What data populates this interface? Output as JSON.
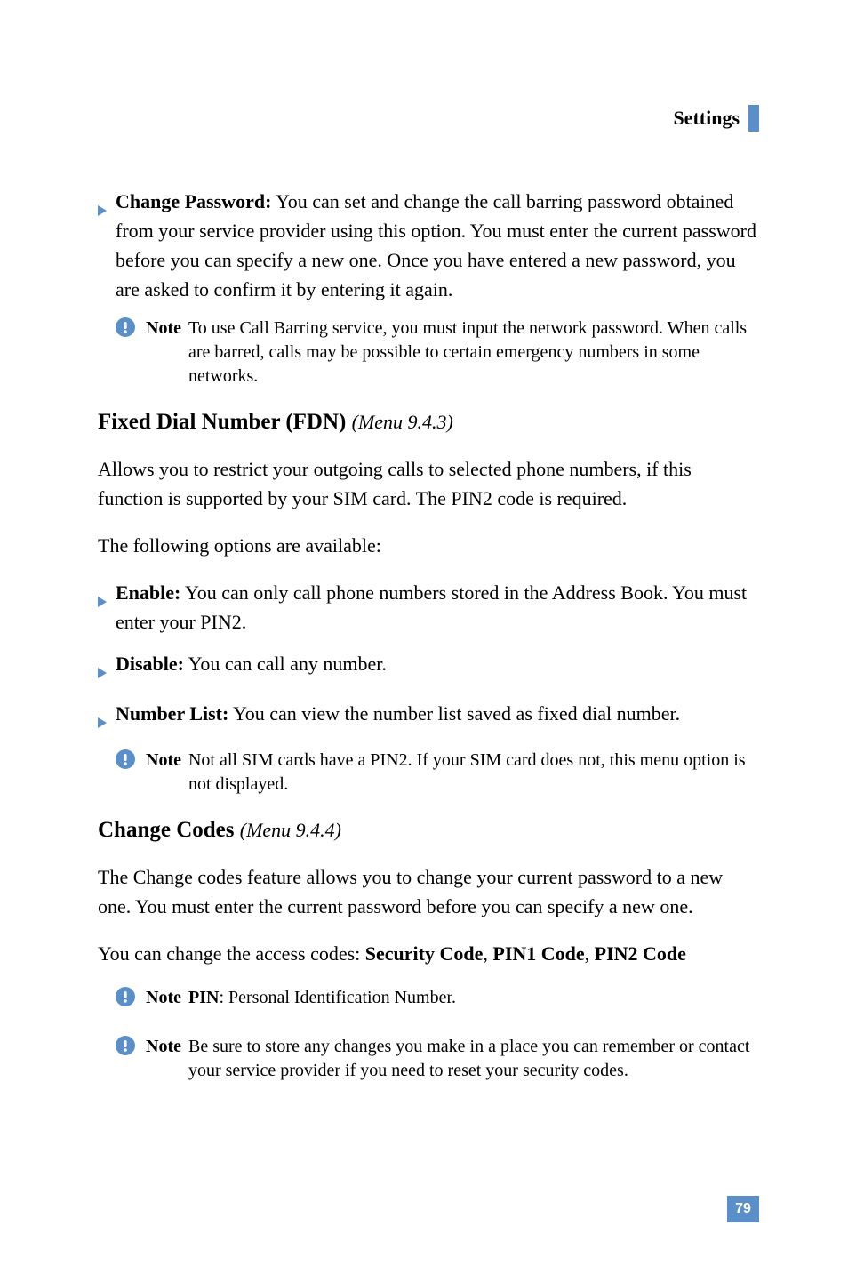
{
  "header": {
    "title": "Settings"
  },
  "changePassword": {
    "label": "Change Password:",
    "text": " You can set and change the call barring password obtained from your service provider using this option. You must enter the current password before you can specify a new one. Once you have entered a new password, you are asked to confirm it by entering it again."
  },
  "note1": {
    "label": "Note",
    "text": "To use Call Barring service, you must input the network password. When calls are barred, calls may be possible to certain emergency numbers in some networks."
  },
  "fdn": {
    "heading": "Fixed Dial Number (FDN)",
    "menuRef": "(Menu 9.4.3)",
    "para1": "Allows you to restrict your outgoing calls to selected phone numbers, if this function is supported by your SIM card. The PIN2 code is required.",
    "para2": "The following options are available:",
    "enable": {
      "label": "Enable:",
      "text": " You can only call phone numbers stored in the Address Book. You must enter your PIN2."
    },
    "disable": {
      "label": "Disable:",
      "text": " You can call any number."
    },
    "numberList": {
      "label": "Number List:",
      "text": " You can view the number list saved as fixed dial number."
    }
  },
  "note2": {
    "label": "Note",
    "text": "Not all SIM cards have a PIN2. If your SIM card does not, this menu option is not displayed."
  },
  "changeCodes": {
    "heading": "Change Codes",
    "menuRef": "(Menu 9.4.4)",
    "para1": "The Change codes feature allows you to change your current password to a new one. You must enter the current password before you can specify a new one.",
    "para2_pre": "You can change the access codes: ",
    "code1": "Security Code",
    "sep1": ", ",
    "code2": "PIN1 Code",
    "sep2": ", ",
    "code3": "PIN2 Code"
  },
  "note3": {
    "label": "Note",
    "pinBold": "PIN",
    "text": ": Personal Identification Number."
  },
  "note4": {
    "label": "Note",
    "text": "Be sure to store any changes you make in a place you can remember or contact your service provider if you need to reset your security codes."
  },
  "pageNumber": "79"
}
